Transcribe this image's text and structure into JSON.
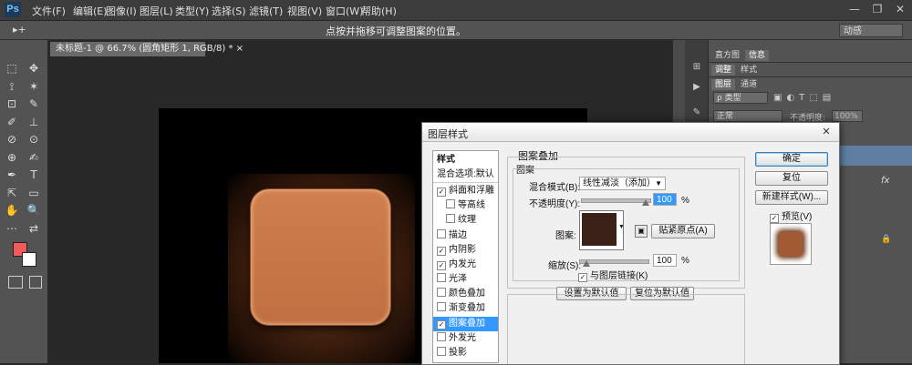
{
  "app": {
    "logo": "Ps"
  },
  "menu": [
    "文件(F)",
    "编辑(E)",
    "图像(I)",
    "图层(L)",
    "类型(Y)",
    "选择(S)",
    "滤镜(T)",
    "视图(V)",
    "窗口(W)",
    "帮助(H)"
  ],
  "window_controls": {
    "minimize": "—",
    "restore": "❐",
    "close": "✕"
  },
  "options_bar": {
    "tool_glyph": "▸+",
    "hint": "点按并拖移可调整图案的位置。",
    "workspace": "动感"
  },
  "document": {
    "tab": "未标题-1 @ 66.7% (圆角矩形 1, RGB/8) *",
    "tab_close": "×"
  },
  "tools": [
    "⬚",
    "✥",
    "⟟",
    "✶",
    "⊡",
    "✎",
    "✐",
    "⊥",
    "⊘",
    "⊙",
    "⊕",
    "✍",
    "✒",
    "T",
    "⇱",
    "▭",
    "✋",
    "🔍",
    "⋯",
    "⇄"
  ],
  "colors": {
    "foreground": "#f35a5a",
    "background": "#ffffff",
    "accent": "#3399ff",
    "canvas_bg": "#282828",
    "tile": "#c87646"
  },
  "panels": {
    "tabs_row1": [
      "直方图",
      "信息"
    ],
    "tabs_row2": [
      "调整",
      "样式"
    ],
    "tabs_row3": [
      "图层",
      "通道"
    ],
    "filter_label": "ρ 类型",
    "blend_mode": "正常",
    "opacity_label": "不透明度:",
    "opacity_value": "100%",
    "fx": "fx",
    "lock_icon": "🔒"
  },
  "dialog": {
    "title": "图层样式",
    "close": "✕",
    "style_list": [
      {
        "label": "样式",
        "check": false,
        "indent": false,
        "bold": true
      },
      {
        "label": "混合选项:默认",
        "check": false,
        "indent": false,
        "bold": false
      },
      {
        "label": "斜面和浮雕",
        "check": true,
        "checked": true,
        "indent": false
      },
      {
        "label": "等高线",
        "check": true,
        "checked": false,
        "indent": true
      },
      {
        "label": "纹理",
        "check": true,
        "checked": false,
        "indent": true
      },
      {
        "label": "描边",
        "check": true,
        "checked": false,
        "indent": false
      },
      {
        "label": "内阴影",
        "check": true,
        "checked": true,
        "indent": false
      },
      {
        "label": "内发光",
        "check": true,
        "checked": true,
        "indent": false
      },
      {
        "label": "光泽",
        "check": true,
        "checked": false,
        "indent": false
      },
      {
        "label": "颜色叠加",
        "check": true,
        "checked": false,
        "indent": false
      },
      {
        "label": "渐变叠加",
        "check": true,
        "checked": false,
        "indent": false
      },
      {
        "label": "图案叠加",
        "check": true,
        "checked": true,
        "indent": false,
        "selected": true
      },
      {
        "label": "外发光",
        "check": true,
        "checked": false,
        "indent": false
      },
      {
        "label": "投影",
        "check": true,
        "checked": false,
        "indent": false
      }
    ],
    "section_title": "图案叠加",
    "group_title": "图案",
    "blend_mode_label": "混合模式(B):",
    "blend_mode_value": "线性减淡（添加）",
    "opacity_label": "不透明度(Y):",
    "opacity_value": "100",
    "percent": "%",
    "opacity_level": 1.0,
    "pattern_label": "图案:",
    "snap_button": "贴紧原点(A)",
    "scale_label": "缩放(S):",
    "scale_value": "100",
    "scale_level": 0.1,
    "link_label": "与图层链接(K)",
    "link_checked": true,
    "set_default": "设置为默认值",
    "reset_default": "复位为默认值",
    "ok": "确定",
    "reset": "复位",
    "new_style": "新建样式(W)...",
    "preview_label": "预览(V)",
    "preview_checked": true,
    "pattern_color": "#3a2218"
  }
}
